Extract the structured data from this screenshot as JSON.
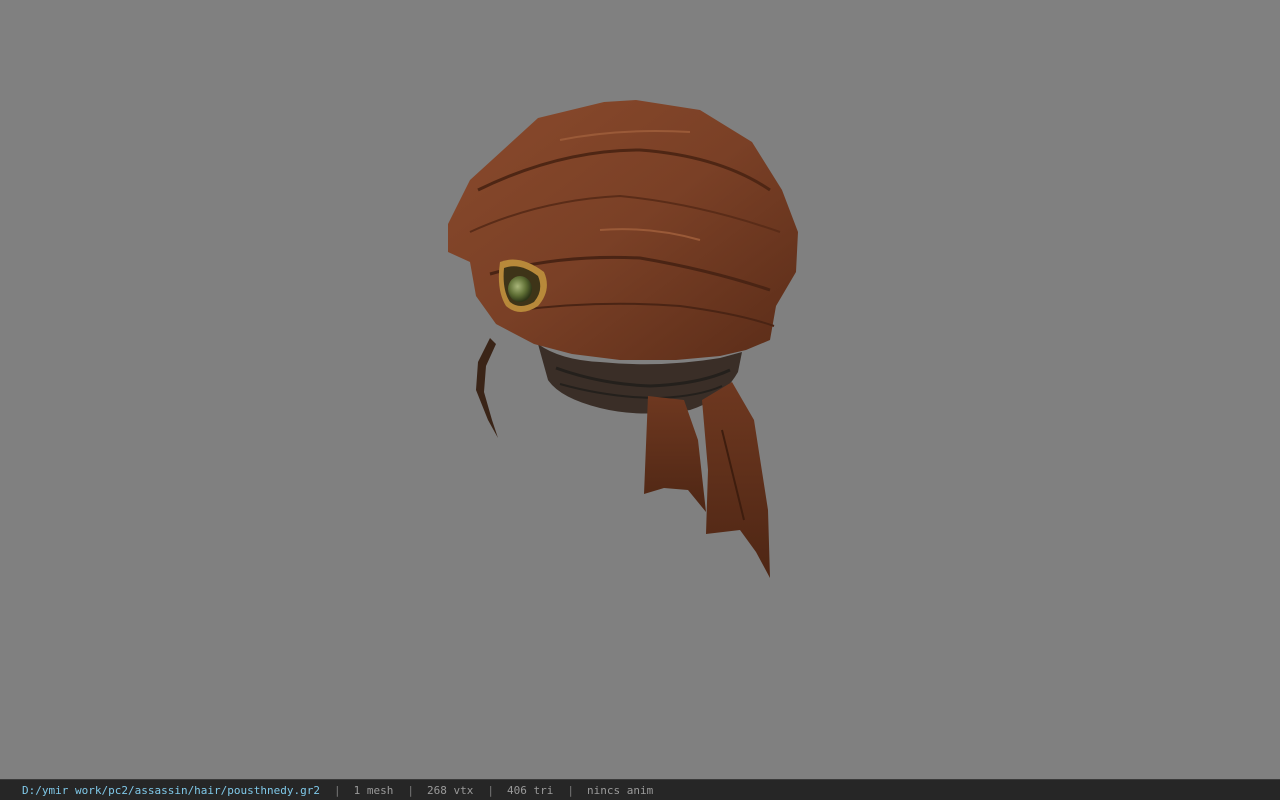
{
  "colors": {
    "background": "#808080",
    "status_bar": "#262626",
    "path_text": "#7fc8e8",
    "info_text": "#9a9a9a",
    "cloth": "#7a4026",
    "hair": "#3a2e27"
  },
  "model": {
    "icon": "headscarf-with-brooch-model"
  },
  "status": {
    "file_path": "D:/ymir work/pc2/assassin/hair/pousthnedy.gr2",
    "separator": "|",
    "mesh": "1 mesh",
    "vertices": "268 vtx",
    "triangles": "406 tri",
    "animation": "nincs anim"
  }
}
